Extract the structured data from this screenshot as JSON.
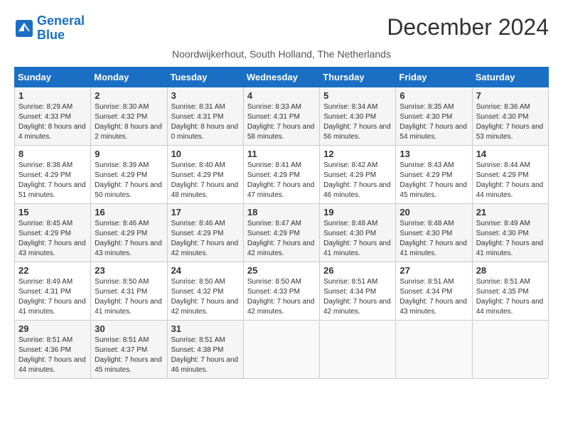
{
  "logo": {
    "line1": "General",
    "line2": "Blue"
  },
  "title": "December 2024",
  "subtitle": "Noordwijkerhout, South Holland, The Netherlands",
  "weekdays": [
    "Sunday",
    "Monday",
    "Tuesday",
    "Wednesday",
    "Thursday",
    "Friday",
    "Saturday"
  ],
  "weeks": [
    [
      {
        "day": "1",
        "sunrise": "Sunrise: 8:29 AM",
        "sunset": "Sunset: 4:33 PM",
        "daylight": "Daylight: 8 hours and 4 minutes."
      },
      {
        "day": "2",
        "sunrise": "Sunrise: 8:30 AM",
        "sunset": "Sunset: 4:32 PM",
        "daylight": "Daylight: 8 hours and 2 minutes."
      },
      {
        "day": "3",
        "sunrise": "Sunrise: 8:31 AM",
        "sunset": "Sunset: 4:31 PM",
        "daylight": "Daylight: 8 hours and 0 minutes."
      },
      {
        "day": "4",
        "sunrise": "Sunrise: 8:33 AM",
        "sunset": "Sunset: 4:31 PM",
        "daylight": "Daylight: 7 hours and 58 minutes."
      },
      {
        "day": "5",
        "sunrise": "Sunrise: 8:34 AM",
        "sunset": "Sunset: 4:30 PM",
        "daylight": "Daylight: 7 hours and 56 minutes."
      },
      {
        "day": "6",
        "sunrise": "Sunrise: 8:35 AM",
        "sunset": "Sunset: 4:30 PM",
        "daylight": "Daylight: 7 hours and 54 minutes."
      },
      {
        "day": "7",
        "sunrise": "Sunrise: 8:36 AM",
        "sunset": "Sunset: 4:30 PM",
        "daylight": "Daylight: 7 hours and 53 minutes."
      }
    ],
    [
      {
        "day": "8",
        "sunrise": "Sunrise: 8:38 AM",
        "sunset": "Sunset: 4:29 PM",
        "daylight": "Daylight: 7 hours and 51 minutes."
      },
      {
        "day": "9",
        "sunrise": "Sunrise: 8:39 AM",
        "sunset": "Sunset: 4:29 PM",
        "daylight": "Daylight: 7 hours and 50 minutes."
      },
      {
        "day": "10",
        "sunrise": "Sunrise: 8:40 AM",
        "sunset": "Sunset: 4:29 PM",
        "daylight": "Daylight: 7 hours and 48 minutes."
      },
      {
        "day": "11",
        "sunrise": "Sunrise: 8:41 AM",
        "sunset": "Sunset: 4:29 PM",
        "daylight": "Daylight: 7 hours and 47 minutes."
      },
      {
        "day": "12",
        "sunrise": "Sunrise: 8:42 AM",
        "sunset": "Sunset: 4:29 PM",
        "daylight": "Daylight: 7 hours and 46 minutes."
      },
      {
        "day": "13",
        "sunrise": "Sunrise: 8:43 AM",
        "sunset": "Sunset: 4:29 PM",
        "daylight": "Daylight: 7 hours and 45 minutes."
      },
      {
        "day": "14",
        "sunrise": "Sunrise: 8:44 AM",
        "sunset": "Sunset: 4:29 PM",
        "daylight": "Daylight: 7 hours and 44 minutes."
      }
    ],
    [
      {
        "day": "15",
        "sunrise": "Sunrise: 8:45 AM",
        "sunset": "Sunset: 4:29 PM",
        "daylight": "Daylight: 7 hours and 43 minutes."
      },
      {
        "day": "16",
        "sunrise": "Sunrise: 8:46 AM",
        "sunset": "Sunset: 4:29 PM",
        "daylight": "Daylight: 7 hours and 43 minutes."
      },
      {
        "day": "17",
        "sunrise": "Sunrise: 8:46 AM",
        "sunset": "Sunset: 4:29 PM",
        "daylight": "Daylight: 7 hours and 42 minutes."
      },
      {
        "day": "18",
        "sunrise": "Sunrise: 8:47 AM",
        "sunset": "Sunset: 4:29 PM",
        "daylight": "Daylight: 7 hours and 42 minutes."
      },
      {
        "day": "19",
        "sunrise": "Sunrise: 8:48 AM",
        "sunset": "Sunset: 4:30 PM",
        "daylight": "Daylight: 7 hours and 41 minutes."
      },
      {
        "day": "20",
        "sunrise": "Sunrise: 8:48 AM",
        "sunset": "Sunset: 4:30 PM",
        "daylight": "Daylight: 7 hours and 41 minutes."
      },
      {
        "day": "21",
        "sunrise": "Sunrise: 8:49 AM",
        "sunset": "Sunset: 4:30 PM",
        "daylight": "Daylight: 7 hours and 41 minutes."
      }
    ],
    [
      {
        "day": "22",
        "sunrise": "Sunrise: 8:49 AM",
        "sunset": "Sunset: 4:31 PM",
        "daylight": "Daylight: 7 hours and 41 minutes."
      },
      {
        "day": "23",
        "sunrise": "Sunrise: 8:50 AM",
        "sunset": "Sunset: 4:31 PM",
        "daylight": "Daylight: 7 hours and 41 minutes."
      },
      {
        "day": "24",
        "sunrise": "Sunrise: 8:50 AM",
        "sunset": "Sunset: 4:32 PM",
        "daylight": "Daylight: 7 hours and 42 minutes."
      },
      {
        "day": "25",
        "sunrise": "Sunrise: 8:50 AM",
        "sunset": "Sunset: 4:33 PM",
        "daylight": "Daylight: 7 hours and 42 minutes."
      },
      {
        "day": "26",
        "sunrise": "Sunrise: 8:51 AM",
        "sunset": "Sunset: 4:34 PM",
        "daylight": "Daylight: 7 hours and 42 minutes."
      },
      {
        "day": "27",
        "sunrise": "Sunrise: 8:51 AM",
        "sunset": "Sunset: 4:34 PM",
        "daylight": "Daylight: 7 hours and 43 minutes."
      },
      {
        "day": "28",
        "sunrise": "Sunrise: 8:51 AM",
        "sunset": "Sunset: 4:35 PM",
        "daylight": "Daylight: 7 hours and 44 minutes."
      }
    ],
    [
      {
        "day": "29",
        "sunrise": "Sunrise: 8:51 AM",
        "sunset": "Sunset: 4:36 PM",
        "daylight": "Daylight: 7 hours and 44 minutes."
      },
      {
        "day": "30",
        "sunrise": "Sunrise: 8:51 AM",
        "sunset": "Sunset: 4:37 PM",
        "daylight": "Daylight: 7 hours and 45 minutes."
      },
      {
        "day": "31",
        "sunrise": "Sunrise: 8:51 AM",
        "sunset": "Sunset: 4:38 PM",
        "daylight": "Daylight: 7 hours and 46 minutes."
      },
      null,
      null,
      null,
      null
    ]
  ]
}
